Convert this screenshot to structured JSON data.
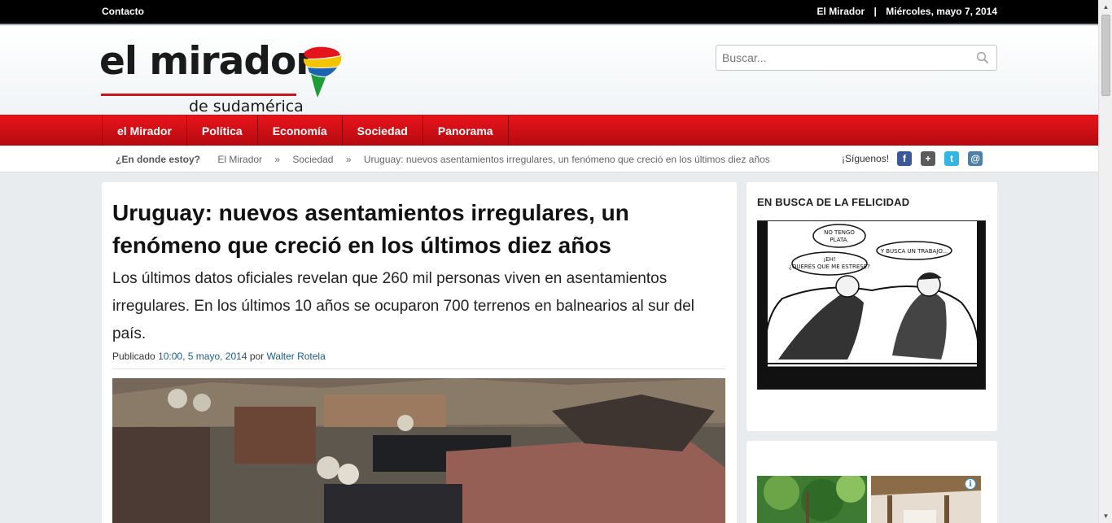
{
  "topbar": {
    "contact": "Contacto",
    "site": "El Mirador",
    "separator": "|",
    "date": "Miércoles, mayo 7, 2014"
  },
  "logo": {
    "name": "el mirador",
    "tagline": "de sudamérica"
  },
  "search": {
    "placeholder": "Buscar..."
  },
  "nav": {
    "items": [
      "el Mirador",
      "Política",
      "Economía",
      "Sociedad",
      "Panorama"
    ]
  },
  "breadcrumb": {
    "lead": "¿En donde estoy?",
    "items": [
      "El Mirador",
      "Sociedad",
      "Uruguay: nuevos asentamientos irregulares, un fenómeno que creció en los últimos diez años"
    ],
    "arrow": "»"
  },
  "social": {
    "label": "¡Síguenos!",
    "icons": [
      "facebook-icon",
      "google-plus-icon",
      "twitter-icon",
      "email-icon"
    ],
    "colors": {
      "facebook": "#3b5998",
      "google": "#5a5a5a",
      "twitter": "#33b5e5",
      "email": "#4d7fa7"
    }
  },
  "article": {
    "title": "Uruguay: nuevos asentamientos irregulares, un fenómeno que creció en los últimos diez años",
    "lede": "Los últimos datos oficiales revelan que 260 mil personas viven en asentamientos irregulares. En los últimos 10 años se ocuparon 700 terrenos en balnearios al sur del país.",
    "published_label": "Publicado",
    "published_time": "10:00, 5 mayo, 2014",
    "by_label": "por",
    "author": "Walter Rotela"
  },
  "sidebar": {
    "widget_title": "EN BUSCA DE LA FELICIDAD",
    "comic": {
      "bubble1": "NO TENGO PLATA.",
      "bubble2": "¡EH! ¿QUERÉS QUE ME ESTRESE?",
      "bubble3": "Y BUSCA UN TRABAJO..."
    },
    "ad_info": "i"
  },
  "colors": {
    "nav_red": "#d9101a",
    "link_blue": "#1f5b8a"
  }
}
